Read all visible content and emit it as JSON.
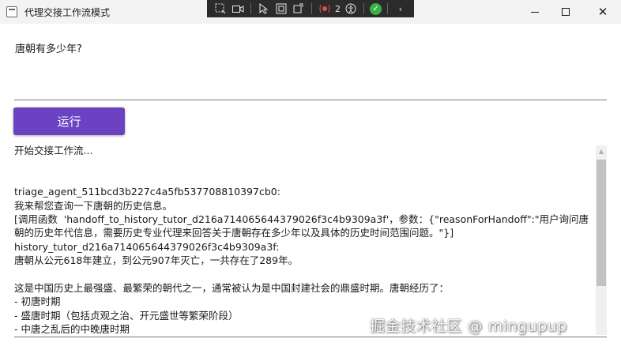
{
  "window": {
    "title": "代理交接工作流模式"
  },
  "toolbar": {
    "icons": [
      "select-region-icon",
      "video-icon",
      "pointer-icon",
      "frame-icon",
      "rotate-icon",
      "record-icon",
      "accessibility-icon",
      "check-icon",
      "chevron-left-icon"
    ],
    "record_count": "2"
  },
  "question": {
    "text": "唐朝有多少年?"
  },
  "run_button": {
    "label": "运行",
    "color": "#6a42c2"
  },
  "output": {
    "lines": [
      "开始交接工作流...",
      "",
      "",
      "triage_agent_511bcd3b227c4a5fb537708810397cb0:",
      "我来帮您查询一下唐朝的历史信息。",
      "[调用函数  'handoff_to_history_tutor_d216a714065644379026f3c4b9309a3f'，参数：{\"reasonForHandoff\":\"用户询问唐朝的历史年代信息，需要历史专业代理来回答关于唐朝存在多少年以及具体的历史时间范围问题。\"}]",
      "history_tutor_d216a714065644379026f3c4b9309a3f:",
      "唐朝从公元618年建立，到公元907年灭亡，一共存在了289年。",
      "",
      "这是中国历史上最强盛、最繁荣的朝代之一，通常被认为是中国封建社会的鼎盛时期。唐朝经历了：",
      "- 初唐时期",
      "- 盛唐时期（包括贞观之治、开元盛世等繁荣阶段）",
      "- 中唐之乱后的中晚唐时期"
    ]
  },
  "watermark": {
    "text": "掘金技术社区 @ mingupup"
  }
}
